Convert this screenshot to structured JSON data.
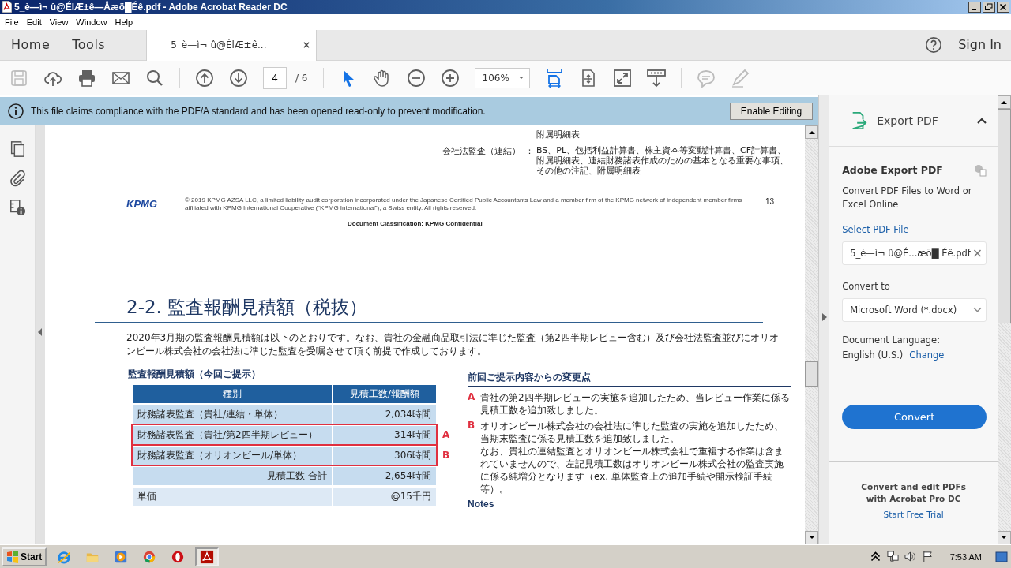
{
  "window": {
    "title": "5_è—ì¬ û@ÉlÆ±ê—Åæö█Éê.pdf - Adobe Acrobat Reader DC"
  },
  "menu": [
    "File",
    "Edit",
    "View",
    "Window",
    "Help"
  ],
  "tabs": [
    {
      "label": "Home",
      "selected": false,
      "kind": "nav"
    },
    {
      "label": "Tools",
      "selected": false,
      "kind": "nav"
    },
    {
      "label": "5_è—ì¬ û@ÉlÆ±ê...",
      "selected": true,
      "kind": "document"
    }
  ],
  "account": {
    "sign_in": "Sign In"
  },
  "toolbar": {
    "page_number": "4",
    "page_count": "/ 6",
    "zoom": "106%",
    "tools": [
      {
        "kind": "save",
        "selected": false,
        "disabled": true
      },
      {
        "kind": "upload",
        "selected": false,
        "disabled": false
      },
      {
        "kind": "print",
        "selected": false,
        "disabled": false
      },
      {
        "kind": "mail",
        "selected": false,
        "disabled": false
      },
      {
        "kind": "search",
        "selected": false,
        "disabled": false
      },
      {
        "kind": "sep"
      },
      {
        "kind": "up",
        "selected": false,
        "disabled": false
      },
      {
        "kind": "down",
        "selected": false,
        "disabled": false
      },
      {
        "kind": "page"
      },
      {
        "kind": "sep"
      },
      {
        "kind": "select",
        "selected": true,
        "disabled": false
      },
      {
        "kind": "hand",
        "selected": false,
        "disabled": false
      },
      {
        "kind": "zoomout",
        "selected": false,
        "disabled": false
      },
      {
        "kind": "zoomin",
        "selected": false,
        "disabled": false
      },
      {
        "kind": "zoom"
      },
      {
        "kind": "scroll",
        "selected": true,
        "disabled": false
      },
      {
        "kind": "fit",
        "selected": false,
        "disabled": false
      },
      {
        "kind": "full",
        "selected": false,
        "disabled": false
      },
      {
        "kind": "read",
        "selected": false,
        "disabled": false
      },
      {
        "kind": "sep"
      },
      {
        "kind": "comment",
        "selected": false,
        "disabled": true
      },
      {
        "kind": "pen",
        "selected": false,
        "disabled": true
      }
    ]
  },
  "banner": {
    "message": "This file claims compliance with the PDF/A standard and has been opened read-only to prevent modification.",
    "button": "Enable Editing"
  },
  "document": {
    "top_right": "附属明細表",
    "scope": {
      "label": "会社法監査（連結）",
      "colon": "：",
      "lines": [
        "BS、PL、包括利益計算書、株主資本等変動計算書、CF計算書、",
        "附属明細表、連結財務諸表作成のための基本となる重要な事項、",
        "その他の注記、附属明細表"
      ]
    },
    "footer": {
      "logo": "KPMG",
      "legal": [
        "© 2019 KPMG AZSA LLC, a limited liability audit corporation incorporated under the Japanese Certified Public Accountants Law and a member firm of the KPMG network of independent member firms",
        "affiliated with KPMG International Cooperative (“KPMG International”), a Swiss entity. All rights reserved."
      ],
      "page": "13",
      "classification": "Document Classification: KPMG Confidential"
    },
    "heading": "2-2. 監査報酬見積額（税抜）",
    "intro": "2020年3月期の監査報酬見積額は以下のとおりです。なお、貴社の金融商品取引法に準じた監査（第2四半期レビュー含む）及び会社法監査並びにオリオンビール株式会社の会社法に準じた監査を受嘱させて頂く前提で作成しております。",
    "table": {
      "title": "監査報酬見積額（今回ご提示）",
      "columns": [
        "種別",
        "見積工数/報酬額"
      ],
      "rows": [
        {
          "kind": "item",
          "label": "財務諸表監査（貴社/連結・単体）",
          "value": "2,034時間",
          "flagged": false
        },
        {
          "kind": "item",
          "label": "財務諸表監査（貴社/第2四半期レビュー）",
          "value": "314時間",
          "flagged": true,
          "marker": "A"
        },
        {
          "kind": "item",
          "label": "財務諸表監査（オリオンビール/単体）",
          "value": "306時間",
          "flagged": true,
          "marker": "B"
        },
        {
          "kind": "total",
          "label": "見積工数 合計",
          "value": "2,654時間",
          "flagged": false
        },
        {
          "kind": "unit",
          "label": "単価",
          "value": "@15千円",
          "flagged": false
        }
      ]
    },
    "changes": {
      "title": "前回ご提示内容からの変更点",
      "items": [
        {
          "marker": "A",
          "text": "貴社の第2四半期レビューの実施を追加したため、当レビュー作業に係る見積工数を追加致しました。"
        },
        {
          "marker": "B",
          "text": "オリオンビール株式会社の会社法に準じた監査の実施を追加したため、当期末監査に係る見積工数を追加致しました。",
          "note": "なお、貴社の連結監査とオリオンビール株式会社で重複する作業は含まれていませんので、左記見積工数はオリオンビール株式会社の監査実施に係る純増分となります（ex. 単体監査上の追加手続や開示検証手続等）。"
        }
      ]
    },
    "notes_heading": "Notes"
  },
  "panel": {
    "title": "Export PDF",
    "expanded": true,
    "heading": "Adobe Export PDF",
    "description": "Convert PDF Files to Word or Excel Online",
    "select_label": "Select PDF File",
    "file": "5_è—ì¬ û@É...æö█ Éê.pdf",
    "convert_label": "Convert to",
    "format": "Microsoft Word (*.docx)",
    "language_label": "Document Language:",
    "language": "English (U.S.)",
    "change": "Change",
    "convert": "Convert",
    "promo": "Convert and edit PDFs with Acrobat Pro DC",
    "trial": "Start Free Trial"
  },
  "taskbar": {
    "start": "Start",
    "apps": [
      {
        "kind": "ie",
        "selected": false
      },
      {
        "kind": "folder",
        "selected": false
      },
      {
        "kind": "media",
        "selected": false
      },
      {
        "kind": "chrome",
        "selected": false
      },
      {
        "kind": "opera",
        "selected": false
      },
      {
        "kind": "acrobat",
        "selected": true
      }
    ],
    "clock": "7:53 AM"
  }
}
